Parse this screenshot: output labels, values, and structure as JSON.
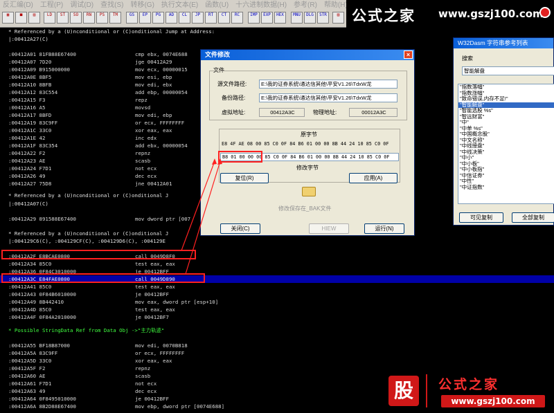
{
  "menu": [
    "反汇编(D)",
    "工程(P)",
    "调试(D)",
    "查找(S)",
    "转移(G)",
    "执行文本(E)",
    "函数(U)",
    "十六进制数据(H)",
    "参考(R)",
    "帮助(H)"
  ],
  "watermark": {
    "name": "公式之家",
    "url": "www.gszj100.com"
  },
  "listing": {
    "ref1": "* Referenced by a (U)nconditional or (C)onditional Jump at Address:",
    "ref1_addr": "|:00412A27(C)",
    "rows_a": [
      {
        "a": ":00412A01 81FB88E67400",
        "i": "cmp ebx, 0074E688"
      },
      {
        "a": ":00412A07 7D20",
        "i": "jge 00412A29"
      },
      {
        "a": ":00412A09 B915000000",
        "i": "mov ecx, 00000015"
      },
      {
        "a": ":00412A0E 8BF5",
        "i": "mov esi, ebp"
      },
      {
        "a": ":00412A10 8BFB",
        "i": "mov edi, ebx"
      },
      {
        "a": ":00412A12 83C554",
        "i": "add ebp, 00000054"
      },
      {
        "a": ":00412A15 F3",
        "i": "repz"
      },
      {
        "a": ":00412A16 A5",
        "i": "movsd"
      },
      {
        "a": ":00412A17 8BFD",
        "i": "mov edi, ebp"
      },
      {
        "a": ":00412A19 83C9FF",
        "i": "or ecx, FFFFFFFF"
      },
      {
        "a": ":00412A1C 33C0",
        "i": "xor eax, eax"
      },
      {
        "a": ":00412A1E 42",
        "i": "inc edx"
      },
      {
        "a": ":00412A1F 83C354",
        "i": "add ebx, 00000054"
      },
      {
        "a": ":00412A22 F2",
        "i": "repnz"
      },
      {
        "a": ":00412A23 AE",
        "i": "scasb"
      },
      {
        "a": ":00412A24 F7D1",
        "i": "not ecx"
      },
      {
        "a": ":00412A26 49",
        "i": "dec ecx"
      },
      {
        "a": ":00412A27 75D8",
        "i": "jne 00412A01"
      }
    ],
    "ref2": "* Referenced by a (U)nconditional or (C)onditional J",
    "ref2_addr": "|:00412A07(C)",
    "row_b": {
      "a": ":00412A29 891588E67400",
      "i": "mov dword ptr [007"
    },
    "ref3": "* Referenced by a (U)nconditional or (C)onditional J",
    "ref3_addr": "|:004129C6(C), :004129CF(C), :004129D6(C), :004129E",
    "rows_c": [
      {
        "a": ":00412A2F E8BCAE0800",
        "i": "call 0049D8F0"
      },
      {
        "a": ":00412A34 85C0",
        "i": "test eax, eax"
      },
      {
        "a": ":00412A36 0F84C3010000",
        "i": "je 00412BFF"
      },
      {
        "a": ":00412A3C E84FAE0800",
        "i": "call 0049D890"
      },
      {
        "a": ":00412A41 85C0",
        "i": "test eax, eax"
      },
      {
        "a": ":00412A43 0F84B6010000",
        "i": "je 00412BFF"
      },
      {
        "a": ":00412A49 8B442410",
        "i": "mov eax, dword ptr [esp+10]"
      },
      {
        "a": ":00412A4D 85C0",
        "i": "test eax, eax"
      },
      {
        "a": ":00412A4F 0F84A2010000",
        "i": "je 00412BF7"
      }
    ],
    "ref4": "* Possible StringData Ref from Data Obj ->\"主力轨迹\"",
    "rows_d": [
      {
        "a": ":00412A55 BF18B87000",
        "i": "mov edi, 0070B818"
      },
      {
        "a": ":00412A5A 83C9FF",
        "i": "or ecx, FFFFFFFF"
      },
      {
        "a": ":00412A5D 33C0",
        "i": "xor eax, eax"
      },
      {
        "a": ":00412A5F F2",
        "i": "repnz"
      },
      {
        "a": ":00412A60 AE",
        "i": "scasb"
      },
      {
        "a": ":00412A61 F7D1",
        "i": "not ecx"
      },
      {
        "a": ":00412A63 49",
        "i": "dec ecx"
      },
      {
        "a": ":00412A64 0F8495010000",
        "i": "je 00412BFF"
      },
      {
        "a": ":00412A6A 8B2D88E67400",
        "i": "mov ebp, dword ptr [0074E688]"
      }
    ]
  },
  "dialog": {
    "title": "文件修改",
    "group": "文件",
    "src_label": "源文件路径:",
    "src_value": "E:\\我的证券系统\\通达信其他\\平安V1.26\\TdxW龙",
    "bak_label": "备份路径:",
    "bak_value": "E:\\我的证券系统\\通达信其他\\平安V1.26\\TdxW龙",
    "va_label": "虚拟地址:",
    "va_value": "00412A3C",
    "pa_label": "物理地址:",
    "pa_value": "00012A3C",
    "orig_header": "原字节",
    "orig_bytes": "E8 4F AE 08 00 85 C0 0F 84 B6 01 00 00 8B 44 24 10 85 C0 0F",
    "mod_bytes_hl": "B8 01 00 00 00",
    "mod_bytes_rest": "85 C0 0F 84 B6 01 00 00 8B 44 24 10 85 C0 0F",
    "mod_label": "修改字节",
    "restore_btn": "复位(R)",
    "apply_btn": "应用(A)",
    "save_note": "修改保存在_BAK文件",
    "close_btn": "关闭(C)",
    "view_btn": "HIEW",
    "run_btn": "运行(N)"
  },
  "strref": {
    "title": "W32Dasm 字符串参考列表",
    "search_label": "搜索",
    "search_value": "智能解盘",
    "items": [
      "\"指数落幅\"",
      "\"指数涨幅\"",
      "\"致命错误,内存不足!\"",
      "\"智能解盘\"",
      "\"智能选股 %s\"",
      "\"智远财富\"",
      "\"中\"",
      "\"中单 %s\"",
      "\"中国概念股\"",
      "\"中文名称\"",
      "\"中线接盘\"",
      "\"中线决策\"",
      "\"中小\"",
      "\"中小板\"",
      "\"中小板指\"",
      "\"中信证券\"",
      "\"中性\"",
      "\"中证指数\""
    ],
    "selected": 3,
    "copy_btn": "可见复制",
    "copy_all_btn": "全部复制"
  },
  "bottom_brand": {
    "char": "股",
    "name": "公式之家",
    "url": "www.gszj100.com"
  }
}
